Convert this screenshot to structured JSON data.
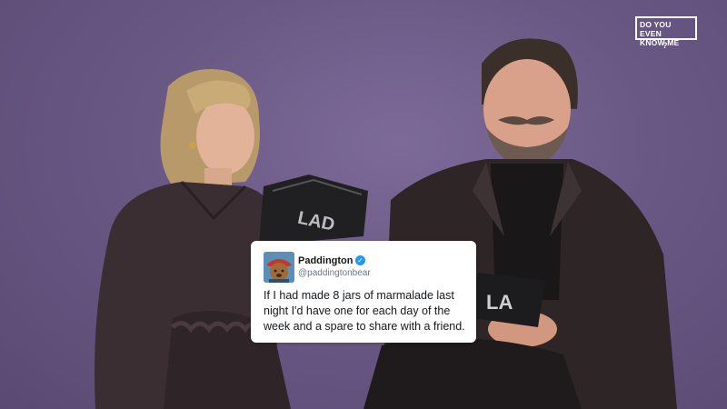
{
  "logo": {
    "line1": "DO YOU EVEN",
    "line2": "KNOW ME",
    "mark": "?"
  },
  "tweet": {
    "name": "Paddington",
    "handle": "@paddingtonbear",
    "verified_icon": "verified-check-icon",
    "text": "If I had made 8 jars of marmalade last night I'd have one for each day of the week and a spare to share with a friend."
  },
  "props": {
    "magazine_text": "LAD",
    "sign_text": "LA"
  },
  "colors": {
    "background": "#6c5a86",
    "card": "#ffffff",
    "verified": "#1d9bf0"
  }
}
